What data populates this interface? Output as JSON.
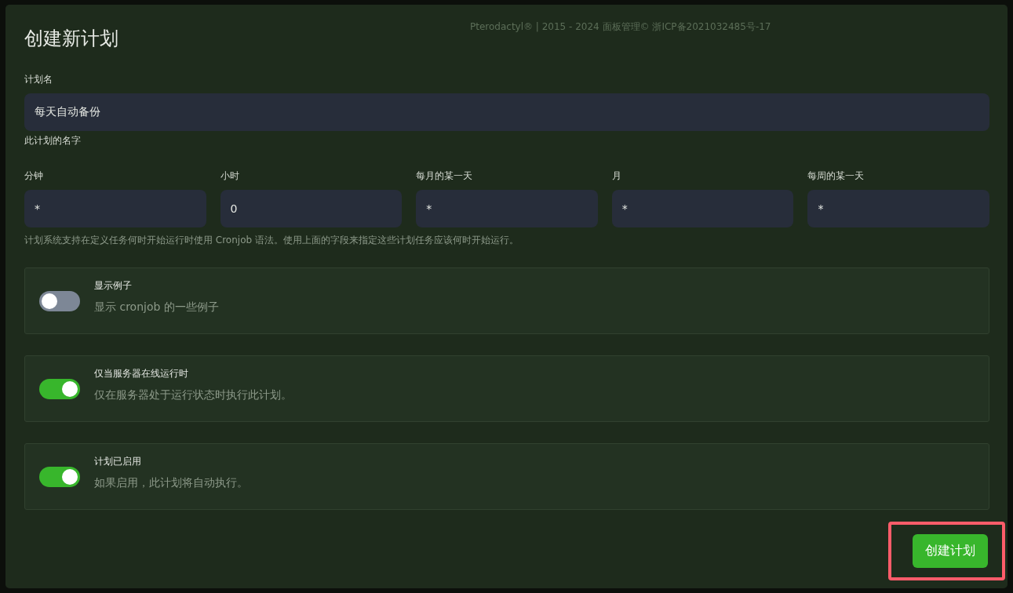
{
  "background_footer": "Pterodactyl® | 2015 - 2024 面板管理© 浙ICP备2021032485号-17",
  "title": "创建新计划",
  "name_field": {
    "label": "计划名",
    "value": "每天自动备份",
    "help": "此计划的名字"
  },
  "cron_fields": [
    {
      "label": "分钟",
      "value": "*"
    },
    {
      "label": "小时",
      "value": "0"
    },
    {
      "label": "每月的某一天",
      "value": "*"
    },
    {
      "label": "月",
      "value": "*"
    },
    {
      "label": "每周的某一天",
      "value": "*"
    }
  ],
  "cron_help": "计划系统支持在定义任务何时开始运行时使用 Cronjob 语法。使用上面的字段来指定这些计划任务应该何时开始运行。",
  "toggles": [
    {
      "title": "显示例子",
      "description": "显示 cronjob 的一些例子",
      "on": false
    },
    {
      "title": "仅当服务器在线运行时",
      "description": "仅在服务器处于运行状态时执行此计划。",
      "on": true
    },
    {
      "title": "计划已启用",
      "description": "如果启用，此计划将自动执行。",
      "on": true
    }
  ],
  "submit": {
    "label": "创建计划",
    "highlighted": true
  }
}
